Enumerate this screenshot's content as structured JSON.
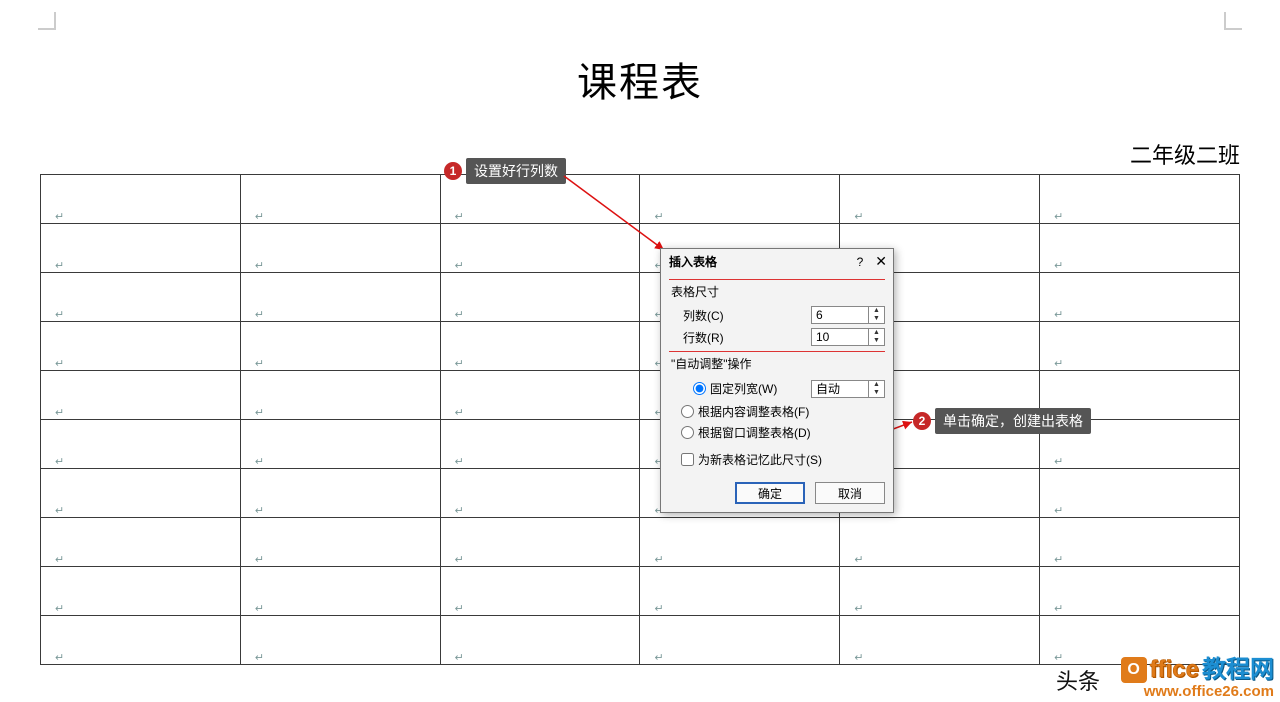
{
  "title": "课程表",
  "subtitle": "二年级二班",
  "table": {
    "rows": 10,
    "cols": 6
  },
  "callouts": {
    "c1": {
      "num": "1",
      "text": "设置好行列数"
    },
    "c2": {
      "num": "2",
      "text": "单击确定，创建出表格"
    }
  },
  "dialog": {
    "title": "插入表格",
    "help": "?",
    "close": "✕",
    "group_size": "表格尺寸",
    "cols_label": "列数(C)",
    "cols_value": "6",
    "rows_label": "行数(R)",
    "rows_value": "10",
    "group_autofit": "\"自动调整\"操作",
    "opt_fixed": "固定列宽(W)",
    "fixed_value": "自动",
    "opt_content": "根据内容调整表格(F)",
    "opt_window": "根据窗口调整表格(D)",
    "remember": "为新表格记忆此尺寸(S)",
    "ok": "确定",
    "cancel": "取消"
  },
  "footer_text": "头条",
  "watermark": {
    "logo": "O",
    "brand1": "ffice",
    "brand2": "教程网",
    "url": "www.office26.com"
  }
}
